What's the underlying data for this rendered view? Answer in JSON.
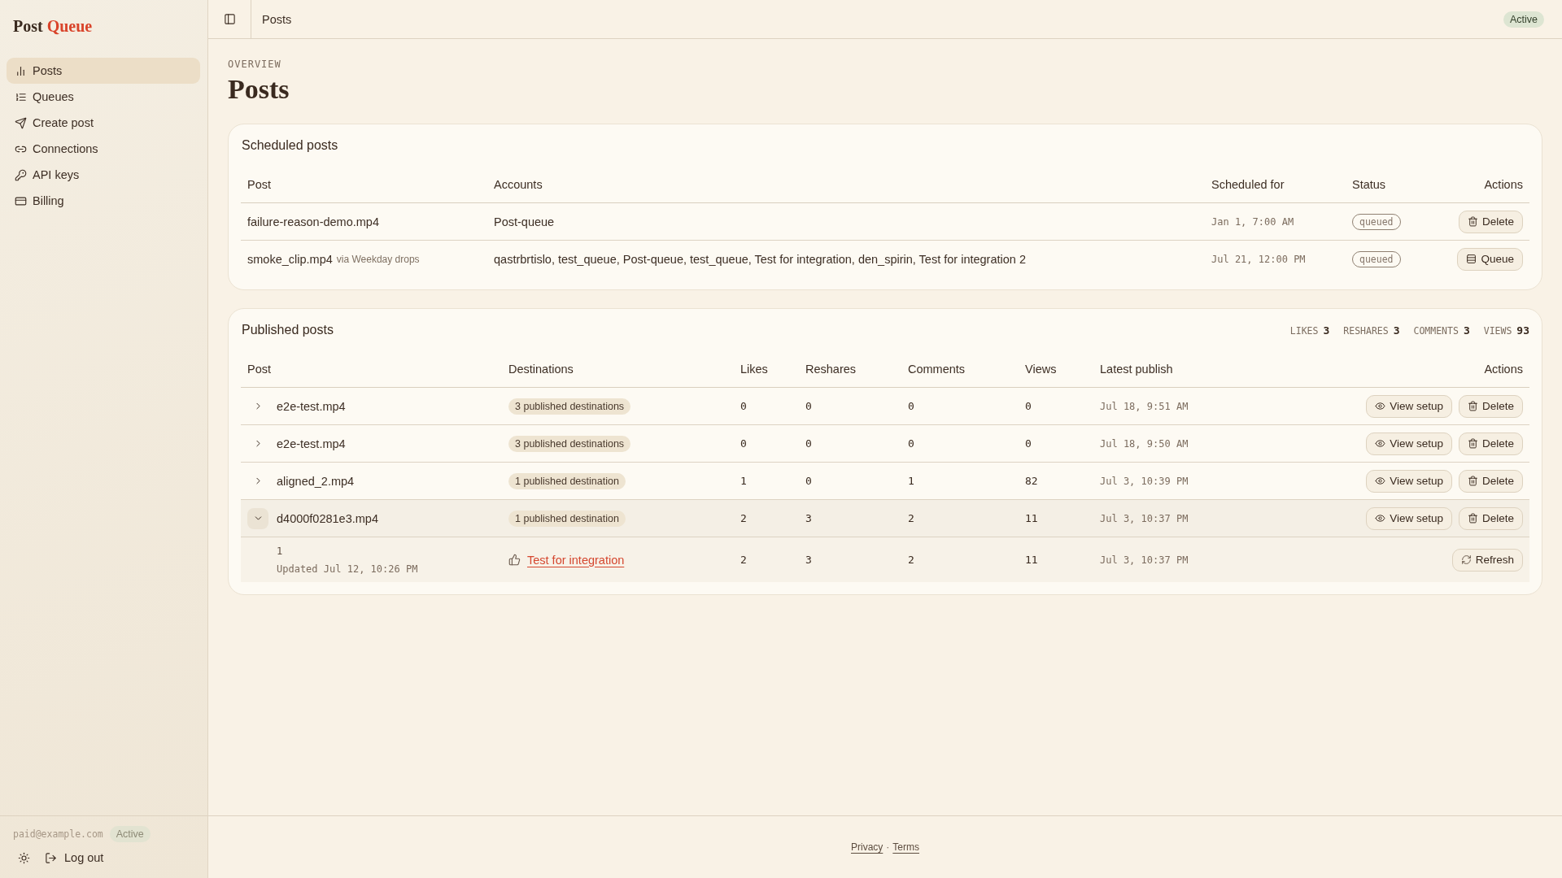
{
  "brand": {
    "name": "Post",
    "accent": "Queue"
  },
  "sidebar": {
    "items": [
      {
        "label": "Posts",
        "selected": true
      },
      {
        "label": "Queues",
        "selected": false
      },
      {
        "label": "Create post",
        "selected": false
      },
      {
        "label": "Connections",
        "selected": false
      },
      {
        "label": "API keys",
        "selected": false
      },
      {
        "label": "Billing",
        "selected": false
      }
    ],
    "account": {
      "email": "paid@example.com",
      "status": "Active"
    },
    "logout": "Log out"
  },
  "topbar": {
    "title": "Posts",
    "status": "Active"
  },
  "header": {
    "eyebrow": "OVERVIEW",
    "title": "Posts"
  },
  "scheduled": {
    "title": "Scheduled posts",
    "columns": [
      "Post",
      "Accounts",
      "Scheduled for",
      "Status",
      "Actions"
    ],
    "rows": [
      {
        "post": "failure-reason-demo.mp4",
        "accounts": "Post-queue",
        "scheduled_for": "Jan 1, 7:00 AM",
        "status": "queued",
        "action": {
          "kind": "delete",
          "label": "Delete"
        }
      },
      {
        "post": "smoke_clip.mp4",
        "via": "via Weekday drops",
        "accounts": "qastrbrtislo, test_queue, Post-queue, test_queue, Test for integration, den_spirin, Test for integration 2",
        "scheduled_for": "Jul 21, 12:00 PM",
        "status": "queued",
        "action": {
          "kind": "queue",
          "label": "Queue"
        }
      }
    ]
  },
  "published": {
    "title": "Published posts",
    "totals": [
      {
        "label": "LIKES",
        "value": "3"
      },
      {
        "label": "RESHARES",
        "value": "3"
      },
      {
        "label": "COMMENTS",
        "value": "3"
      },
      {
        "label": "VIEWS",
        "value": "93"
      }
    ],
    "columns": [
      "Post",
      "Destinations",
      "Likes",
      "Reshares",
      "Comments",
      "Views",
      "Latest publish",
      "Actions"
    ],
    "rows": [
      {
        "post": "e2e-test.mp4",
        "expanded": false,
        "destinations": "3 published destinations",
        "likes": "0",
        "reshares": "0",
        "comments": "0",
        "views": "0",
        "latest": "Jul 18, 9:51 AM",
        "actions": [
          {
            "kind": "view",
            "label": "View setup"
          },
          {
            "kind": "delete",
            "label": "Delete"
          }
        ]
      },
      {
        "post": "e2e-test.mp4",
        "expanded": false,
        "destinations": "3 published destinations",
        "likes": "0",
        "reshares": "0",
        "comments": "0",
        "views": "0",
        "latest": "Jul 18, 9:50 AM",
        "actions": [
          {
            "kind": "view",
            "label": "View setup"
          },
          {
            "kind": "delete",
            "label": "Delete"
          }
        ]
      },
      {
        "post": "aligned_2.mp4",
        "expanded": false,
        "destinations": "1 published destination",
        "likes": "1",
        "reshares": "0",
        "comments": "1",
        "views": "82",
        "latest": "Jul 3, 10:39 PM",
        "actions": [
          {
            "kind": "view",
            "label": "View setup"
          },
          {
            "kind": "delete",
            "label": "Delete"
          }
        ]
      },
      {
        "post": "d4000f0281e3.mp4",
        "expanded": true,
        "destinations": "1 published destination",
        "likes": "2",
        "reshares": "3",
        "comments": "2",
        "views": "11",
        "latest": "Jul 3, 10:37 PM",
        "actions": [
          {
            "kind": "view",
            "label": "View setup"
          },
          {
            "kind": "delete",
            "label": "Delete"
          }
        ],
        "children": [
          {
            "post": "1",
            "updated": "Updated Jul 12, 10:26 PM",
            "destination": "Test for integration",
            "likes": "2",
            "reshares": "3",
            "comments": "2",
            "views": "11",
            "latest": "Jul 3, 10:37 PM",
            "actions": [
              {
                "kind": "refresh",
                "label": "Refresh"
              }
            ]
          }
        ]
      }
    ]
  },
  "footer": {
    "links": [
      "Privacy",
      "Terms"
    ],
    "separator": "·"
  }
}
